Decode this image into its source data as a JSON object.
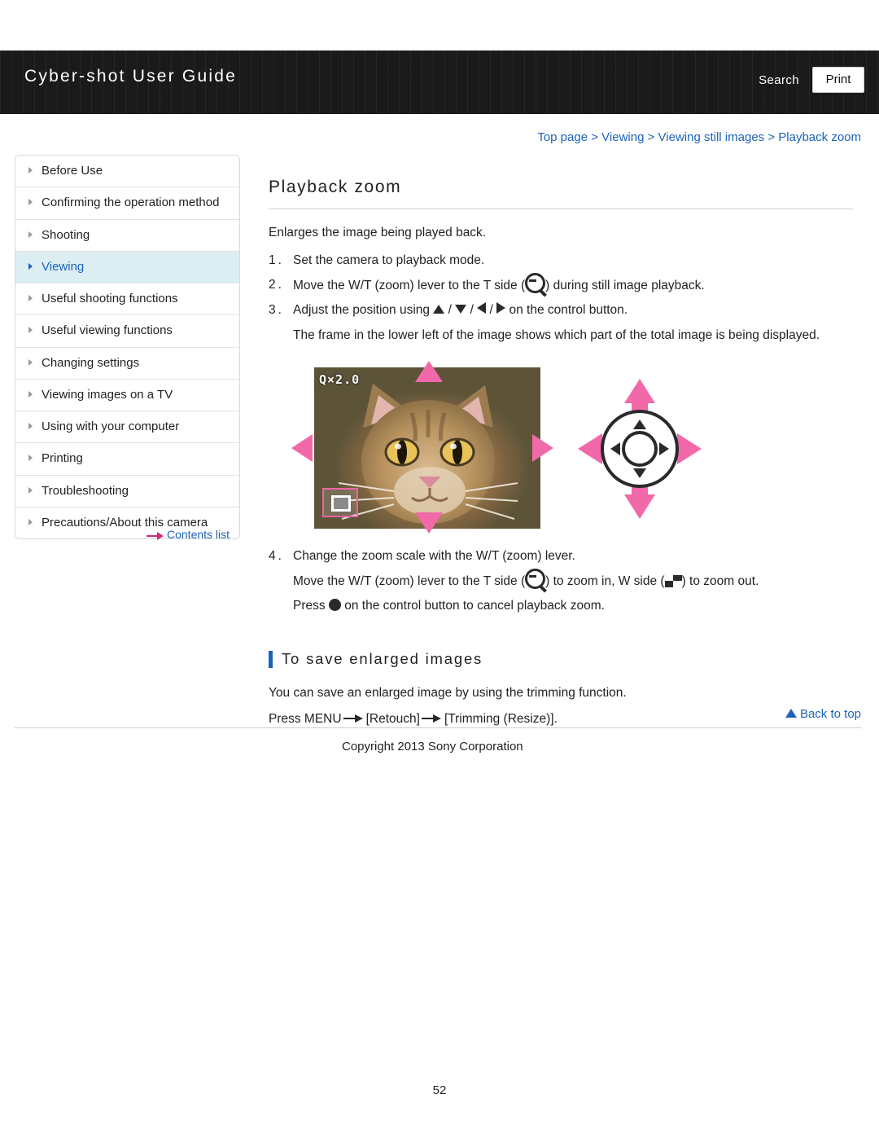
{
  "header": {
    "title": "Cyber-shot User Guide",
    "search_label": "Search",
    "print_label": "Print"
  },
  "breadcrumb": {
    "items": [
      "Top page",
      "Viewing",
      "Viewing still images",
      "Playback zoom"
    ],
    "separator": ">"
  },
  "sidebar": {
    "items": [
      {
        "label": "Before Use",
        "active": false
      },
      {
        "label": "Confirming the operation method",
        "active": false
      },
      {
        "label": "Shooting",
        "active": false
      },
      {
        "label": "Viewing",
        "active": true
      },
      {
        "label": "Useful shooting functions",
        "active": false
      },
      {
        "label": "Useful viewing functions",
        "active": false
      },
      {
        "label": "Changing settings",
        "active": false
      },
      {
        "label": "Viewing images on a TV",
        "active": false
      },
      {
        "label": "Using with your computer",
        "active": false
      },
      {
        "label": "Printing",
        "active": false
      },
      {
        "label": "Troubleshooting",
        "active": false
      },
      {
        "label": "Precautions/About this camera",
        "active": false
      }
    ],
    "contents_list_label": "Contents list"
  },
  "main": {
    "page_title": "Playback zoom",
    "intro": "Enlarges the image being played back.",
    "step1_num": "1.",
    "step1_text": "Set the camera to playback mode.",
    "step2_num": "2.",
    "step2_text_a": "Move the W/T (zoom) lever to the T side (",
    "step2_text_b": ") during still image playback.",
    "step3_num": "3.",
    "step3_text_a": "Adjust the position using",
    "step3_sep": "/",
    "step3_text_b": "on the control button.",
    "step3_note": "The frame in the lower left of the image shows which part of the total image is being displayed.",
    "step4_num": "4.",
    "step4_text": "Change the zoom scale with the W/T (zoom) lever.",
    "step4_line2_a": "Move the W/T (zoom) lever to the T side (",
    "step4_line2_b": ") to zoom in, W side (",
    "step4_line2_c": ") to zoom out.",
    "step4_line3_a": "Press",
    "step4_line3_b": "on the control button to cancel playback zoom.",
    "figure": {
      "zoom_label": "Q×2.0",
      "alt": "cat photo with playback zoom frame and control button diagram"
    },
    "subheading": "To save enlarged images",
    "body1": "You can save an enlarged image by using the trimming function.",
    "body2_a": "Press MENU",
    "body2_b": "[Retouch]",
    "body2_c": "[Trimming (Resize)]."
  },
  "footer": {
    "back_to_top": "Back to top",
    "copyright": "Copyright 2013 Sony Corporation",
    "page_number": "52"
  },
  "colors": {
    "link": "#1c63b8",
    "accent_pink": "#f169a9",
    "header_bg": "#1a1a1a",
    "active_bg": "#ddeef3"
  }
}
